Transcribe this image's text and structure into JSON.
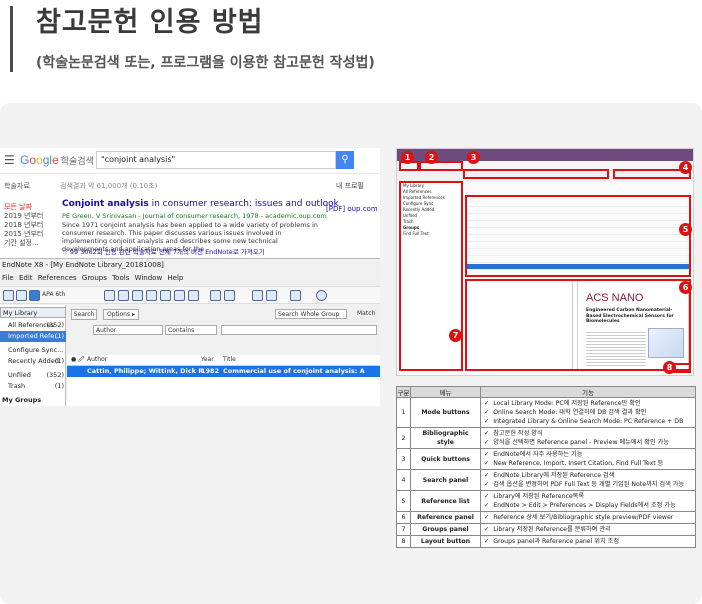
{
  "header": {
    "title": "참고문헌 인용 방법",
    "subtitle": "(학술논문검색 또는, 프로그램을 이용한 참고문헌 작성법)"
  },
  "google_scholar": {
    "logo": "Google",
    "logo_suffix": "학술검색",
    "query": "\"conjoint analysis\"",
    "section_label": "학술자료",
    "result_count": "검색결과 약 61,000개 (0.10초)",
    "my_library": "내 프로필",
    "sidebar": [
      "모든 날짜",
      "2019 년부터",
      "2018 년부터",
      "2015 년부터",
      "기간 설정..."
    ],
    "result": {
      "title_bold": "Conjoint analysis",
      "title_rest": " in consumer research: issues and outlook",
      "pdf": "[PDF] oup.com",
      "authors": "PE Green, V Srinivasan - Journal of consumer research, 1978 - academic.oup.com",
      "snippet": "Since 1971 conjoint analysis has been applied to a wide variety of problems in consumer research. This paper discusses various issues involved in implementing conjoint analysis and describes some new technical developments and application areas for the",
      "links": "☆  99  3062회 인용   관련 학술자료   전체 7개의 버전   EndNote로 가져오기"
    }
  },
  "endnote": {
    "window_title": "EndNote X8 - [My EndNote Library_20181008]",
    "menu": [
      "File",
      "Edit",
      "References",
      "Groups",
      "Tools",
      "Window",
      "Help"
    ],
    "style": "APA 6th",
    "library_header": "My Library",
    "groups": [
      {
        "label": "All References",
        "count": "(352)"
      },
      {
        "label": "Imported Refe...",
        "count": "(1)"
      },
      {
        "label": "Configure Sync...",
        "count": ""
      },
      {
        "label": "Recently Added",
        "count": "(1)"
      },
      {
        "label": "Unfiled",
        "count": "(352)"
      },
      {
        "label": "Trash",
        "count": "(1)"
      }
    ],
    "my_groups": "My Groups",
    "search_btn": "Search",
    "options_btn": "Options ▸",
    "search_scope": "Search Whole Group",
    "match_case": "Match",
    "field_author": "Author",
    "field_contains": "Contains",
    "columns": [
      "Author",
      "Year",
      "Title"
    ],
    "row": {
      "author": "Cattin, Philippe; Wittink, Dick R",
      "year": "1982",
      "title": "Commercial use of conjoint analysis: A survey"
    }
  },
  "right_shot": {
    "badges": [
      "1",
      "2",
      "3",
      "4",
      "5",
      "6",
      "7",
      "8"
    ],
    "side_items": [
      "My Library",
      "All References",
      "Imported References",
      "Configure Sync",
      "Recently Added",
      "Unfiled",
      "Trash",
      "Groups",
      "Find Full Text"
    ],
    "pdf_logo": "ACS NANO",
    "pdf_title": "Engineered Carbon Nanomaterial-Based Electrochemical Sensors for Biomolecules"
  },
  "table": {
    "headers": [
      "구분",
      "메뉴",
      "기능"
    ],
    "rows": [
      {
        "num": "1",
        "menu": "Mode buttons",
        "items": [
          "Local Library Mode: PC에 저장된 Reference만 확인",
          "Online Search Mode: 대학 연결하에 DB 검색 결과 확인",
          "Integrated Library & Online Search Mode: PC Reference + DB"
        ]
      },
      {
        "num": "2",
        "menu": "Bibliographic style",
        "items": [
          "참고문헌 작성 양식",
          "양식을 선택하면 Reference panel - Preview 메뉴에서 확인 가능"
        ]
      },
      {
        "num": "3",
        "menu": "Quick buttons",
        "items": [
          "EndNote에서 자주 사용하는 기능",
          "New Reference, Import, Insert Citation, Find Full Text 등"
        ]
      },
      {
        "num": "4",
        "menu": "Search panel",
        "items": [
          "EndNote Library에 저장된 Reference 검색",
          "검색 옵션을 변경하여 PDF Full Text 등 개별 기입된 Note까지 검색 가능"
        ]
      },
      {
        "num": "5",
        "menu": "Reference list",
        "items": [
          "Library에 저장된 Reference목록",
          "EndNote > Edit > Preferences > Display Fields에서 조정 가능"
        ]
      },
      {
        "num": "6",
        "menu": "Reference panel",
        "items": [
          "Reference 상세 보기/Bibliographic style preview/PDF viewer"
        ]
      },
      {
        "num": "7",
        "menu": "Groups panel",
        "items": [
          "Library 저장된 Reference를 분류하여 관리"
        ]
      },
      {
        "num": "8",
        "menu": "Layout button",
        "items": [
          "Groups panel과 Reference panel 위치 조정"
        ]
      }
    ]
  }
}
